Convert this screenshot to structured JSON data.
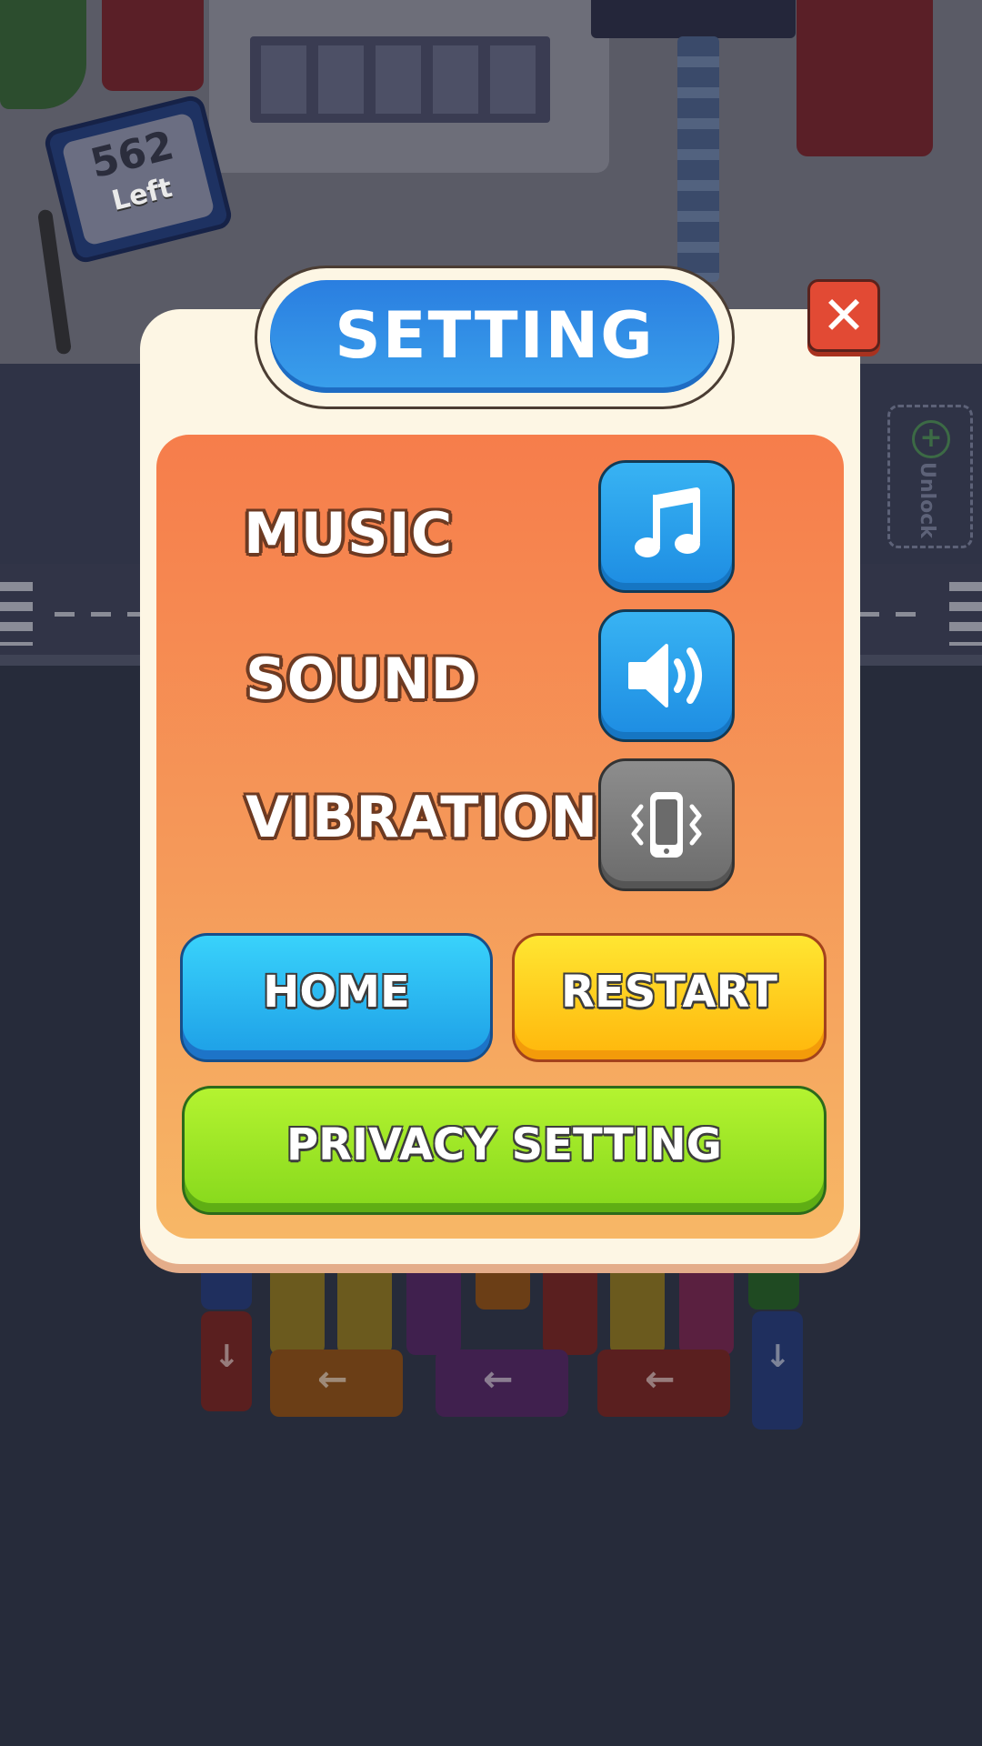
{
  "scene": {
    "sign_count": "562",
    "sign_label": "Left",
    "unlock_label": "Unlock"
  },
  "dialog": {
    "title": "SETTING",
    "close_icon": "close-x-icon",
    "rows": [
      {
        "label": "MUSIC",
        "icon": "music-note-icon",
        "state": "on"
      },
      {
        "label": "SOUND",
        "icon": "speaker-icon",
        "state": "on"
      },
      {
        "label": "VIBRATION",
        "icon": "vibration-phone-icon",
        "state": "off"
      }
    ],
    "buttons": {
      "home": "HOME",
      "restart": "RESTART",
      "privacy": "PRIVACY SETTING"
    }
  },
  "colors": {
    "accent_blue": "#2a7ee0",
    "panel_orange": "#f67d4b",
    "close_red": "#e24a34",
    "privacy_green": "#86d81c",
    "restart_yellow": "#ffb60b"
  }
}
